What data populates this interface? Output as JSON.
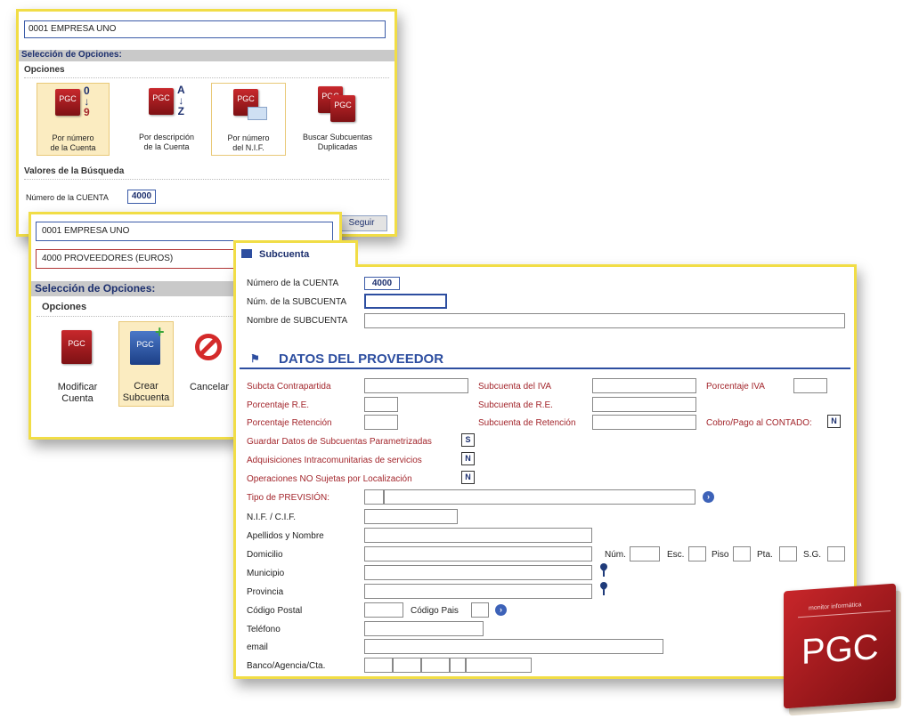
{
  "panel1": {
    "company": "0001 EMPRESA UNO",
    "section_header": "Selección de Opciones:",
    "options_title": "Opciones",
    "options": [
      {
        "line1": "Por número",
        "line2": "de la Cuenta",
        "icon": "pgc-book-0-9-icon"
      },
      {
        "line1": "Por descripción",
        "line2": "de la Cuenta",
        "icon": "pgc-book-a-z-icon"
      },
      {
        "line1": "Por número",
        "line2": "del N.I.F.",
        "icon": "pgc-book-nif-icon"
      },
      {
        "line1": "Buscar Subcuentas",
        "line2": "Duplicadas",
        "icon": "pgc-books-duplicate-icon"
      }
    ],
    "search_values_title": "Valores de la Búsqueda",
    "account_label": "Número de la CUENTA",
    "account_value": "4000",
    "next_button": "Seguir",
    "book_text": "PGC",
    "sym_0": "0",
    "sym_9": "9",
    "sym_a": "A",
    "sym_z": "Z"
  },
  "panel2": {
    "company": "0001 EMPRESA UNO",
    "account": "4000 PROVEEDORES (EUROS)",
    "section_header": "Selección de Opciones:",
    "options_title": "Opciones",
    "actions": [
      {
        "line1": "Modificar",
        "line2": "Cuenta",
        "icon": "pgc-book-edit-icon"
      },
      {
        "line1": "Crear",
        "line2": "Subcuenta",
        "icon": "pgc-book-add-icon"
      },
      {
        "line1": "Cancelar",
        "line2": "",
        "icon": "cancel-icon"
      }
    ]
  },
  "panel3": {
    "title": "Subcuenta",
    "account_label": "Número de la CUENTA",
    "account_value": "4000",
    "subaccount_label": "Núm. de la SUBCUENTA",
    "subaccount_value": "",
    "name_label": "Nombre de SUBCUENTA",
    "name_value": "",
    "section_title": "DATOS DEL PROVEEDOR",
    "labels": {
      "contrapartida": "Subcta Contrapartida",
      "subcuenta_iva": "Subcuenta del IVA",
      "porcentaje_iva": "Porcentaje IVA",
      "porcentaje_re": "Porcentaje R.E.",
      "subcuenta_re": "Subcuenta de R.E.",
      "porcentaje_ret": "Porcentaje Retención",
      "subcuenta_ret": "Subcuenta de Retención",
      "cobro_contado": "Cobro/Pago al CONTADO:",
      "guardar": "Guardar Datos de Subcuentas Parametrizadas",
      "adquisiciones": "Adquisiciones Intracomunitarias de servicios",
      "operaciones": "Operaciones NO Sujetas por Localización",
      "prevision": "Tipo de PREVISIÓN:",
      "nif": "N.I.F. / C.I.F.",
      "apellidos": "Apellidos y Nombre",
      "domicilio": "Domicilio",
      "num": "Núm.",
      "esc": "Esc.",
      "piso": "Piso",
      "pta": "Pta.",
      "sg": "S.G.",
      "municipio": "Municipio",
      "provincia": "Provincia",
      "codigo_postal": "Código Postal",
      "codigo_pais": "Código Pais",
      "telefono": "Teléfono",
      "email": "email",
      "banco": "Banco/Agencia/Cta."
    },
    "flags": {
      "cobro_contado": "N",
      "guardar": "S",
      "adquisiciones": "N",
      "operaciones": "N"
    }
  },
  "logo": {
    "brand": "monitor informática",
    "text": "PGC"
  }
}
